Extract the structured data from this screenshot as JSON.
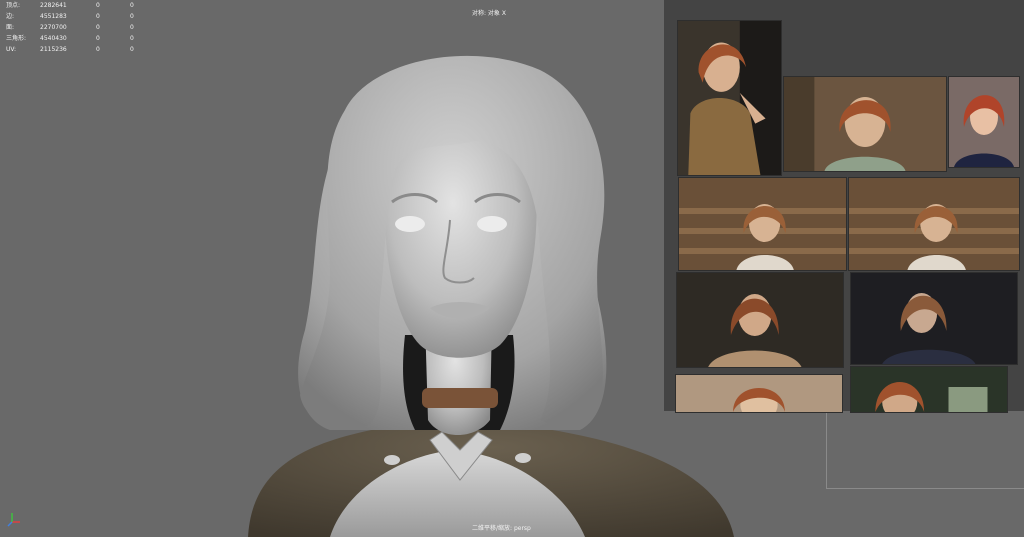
{
  "hud": {
    "rows": [
      {
        "label": "顶点:",
        "v1": "2282641",
        "v2": "0",
        "v3": "0"
      },
      {
        "label": "边:",
        "v1": "4551283",
        "v2": "0",
        "v3": "0"
      },
      {
        "label": "面:",
        "v1": "2270700",
        "v2": "0",
        "v3": "0"
      },
      {
        "label": "三角形:",
        "v1": "4540430",
        "v2": "0",
        "v3": "0"
      },
      {
        "label": "UV:",
        "v1": "2115236",
        "v2": "0",
        "v3": "0"
      }
    ]
  },
  "viewport": {
    "object_label": "对称: 对象 X",
    "camera_label": "二维平移/缩放: persp"
  },
  "reference_panel": {
    "images": [
      "reference-photo-1",
      "reference-photo-2",
      "reference-photo-3",
      "reference-photo-4",
      "reference-photo-5",
      "reference-photo-6",
      "reference-photo-7",
      "reference-photo-8",
      "reference-photo-9"
    ]
  },
  "colors": {
    "viewport_bg": "#696969",
    "panel_bg": "#444444",
    "hair": "#a9a9a9",
    "skin": "#c8c8c8",
    "garment": "#5a5042",
    "collar": "#1a1a1a",
    "choker": "#7a5338",
    "ref_hair": "#a0522d",
    "ref_bg_warm": "#6b5540",
    "ref_bg_dark": "#2a2620"
  }
}
